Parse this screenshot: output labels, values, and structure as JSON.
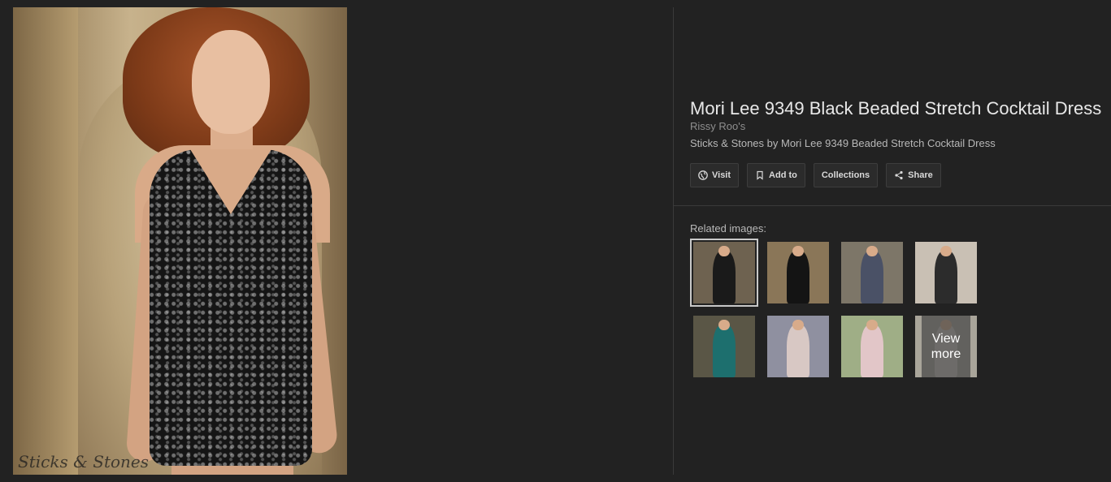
{
  "main_image": {
    "watermark": "Sticks & Stones"
  },
  "details": {
    "title": "Mori Lee 9349 Black Beaded Stretch Cocktail Dress",
    "source": "Rissy Roo's",
    "description": "Sticks & Stones by Mori Lee 9349 Beaded Stretch Cocktail Dress",
    "actions": [
      {
        "label": "Visit",
        "icon": "globe-icon"
      },
      {
        "label": "Add to",
        "icon": "bookmark-icon"
      },
      {
        "label": "Collections",
        "icon": ""
      },
      {
        "label": "Share",
        "icon": "share-icon"
      }
    ]
  },
  "related": {
    "label": "Related images:",
    "view_more": "View more",
    "thumbnails": [
      {
        "selected": true,
        "bg": "#6e6250",
        "dress": "#1a1a1a"
      },
      {
        "selected": false,
        "bg": "#8a7658",
        "dress": "#141414"
      },
      {
        "selected": false,
        "bg": "#7d7668",
        "dress": "#4a5166"
      },
      {
        "selected": false,
        "bg": "#c9c0b4",
        "dress": "#2c2c2c"
      },
      {
        "selected": false,
        "bg": "#5a5646",
        "dress": "#1d6f6e"
      },
      {
        "selected": false,
        "bg": "#8f90a0",
        "dress": "#d8c8c4"
      },
      {
        "selected": false,
        "bg": "#9fae86",
        "dress": "#e2c6c8"
      },
      {
        "selected": false,
        "bg": "#a9a59a",
        "dress": "#cfcac2"
      }
    ]
  },
  "colors": {
    "background": "#222222",
    "panel_text": "#e8e8e8",
    "muted_text": "#8e8e8e",
    "button_bg": "#2b2b2b"
  }
}
